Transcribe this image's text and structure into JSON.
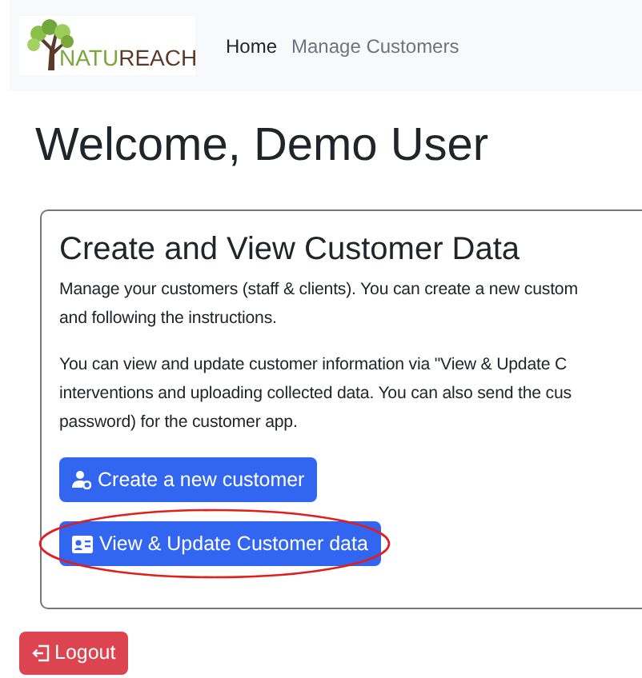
{
  "navbar": {
    "logo": {
      "parts": [
        {
          "text": "NATU",
          "color": "#7aa63a"
        },
        {
          "text": "REACH",
          "color": "#5b3a29"
        }
      ]
    },
    "links": [
      {
        "label": "Home",
        "selected": true
      },
      {
        "label": "Manage Customers",
        "selected": false
      }
    ]
  },
  "heading": "Welcome, Demo User",
  "card": {
    "title": "Create and View Customer Data",
    "paragraphs": [
      [
        "Manage your customers (staff & clients). You can create a new custom",
        "and following the instructions."
      ],
      [
        "You can view and update customer information via \"View & Update C",
        "interventions and uploading collected data. You can also send the cus",
        "password) for the customer app."
      ]
    ],
    "buttons": [
      {
        "label": "Create a new customer",
        "kind": "person-gear",
        "highlighted": false
      },
      {
        "label": "View & Update Customer data",
        "kind": "id-card",
        "highlighted": true
      }
    ]
  },
  "logout": {
    "label": "Logout"
  }
}
